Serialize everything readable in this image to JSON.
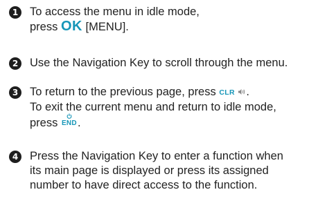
{
  "steps": [
    {
      "number": "1",
      "line1": "To access the menu in idle mode,",
      "line2_prefix": "press",
      "key": "OK",
      "line2_suffix": "[MENU]."
    },
    {
      "number": "2",
      "line1": "Use the Navigation Key to scroll through the menu."
    },
    {
      "number": "3",
      "line1_prefix": "To return to the previous page, press",
      "key1": "CLR",
      "key1_icon": "speaker-icon",
      "line1_suffix": ".",
      "line2": "To exit the current menu and return to idle mode,",
      "line3_prefix": "press",
      "key2": "END",
      "key2_icon": "power-icon",
      "line3_suffix": "."
    },
    {
      "number": "4",
      "line1": "Press the Navigation Key to enter a function when",
      "line2": "its main page is displayed or press its assigned",
      "line3": "number to have direct access to the function."
    }
  ],
  "colors": {
    "key_accent": "#1696b8",
    "badge_background": "#1e1e1e",
    "text": "#222222"
  }
}
